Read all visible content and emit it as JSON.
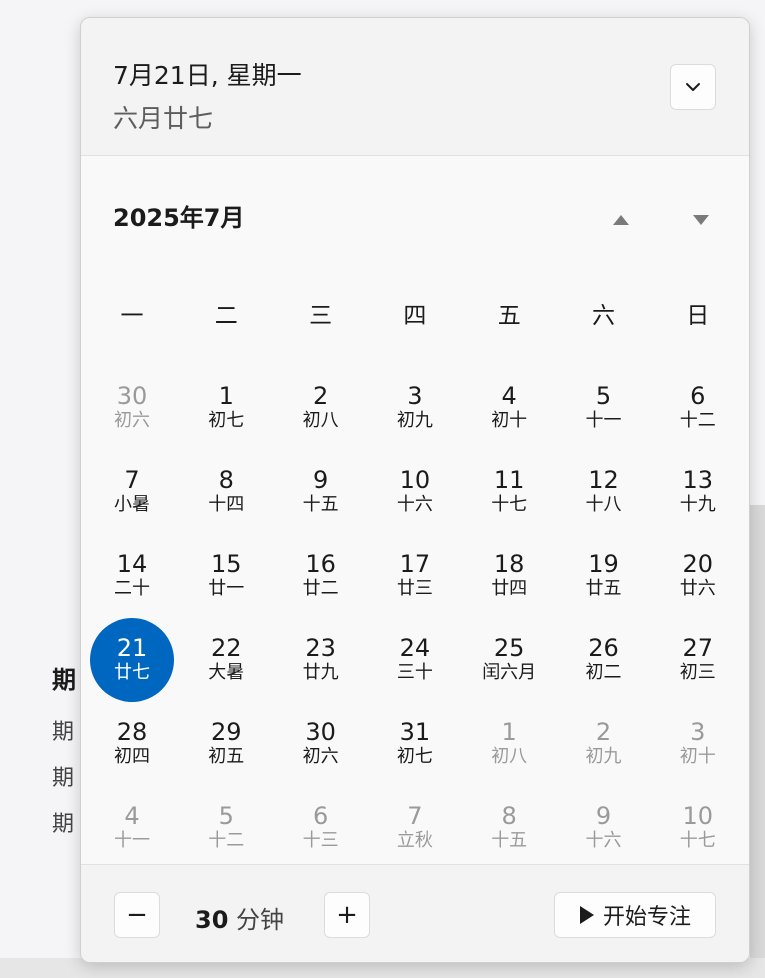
{
  "background": {
    "heading": "期",
    "lines": [
      "期",
      "期",
      "期"
    ]
  },
  "header": {
    "date": "7月21日, 星期一",
    "lunar": "六月廿七",
    "expand_icon": "chevron-down-icon"
  },
  "calendar": {
    "month_title": "2025年7月",
    "prev_icon": "triangle-up-icon",
    "next_icon": "triangle-down-icon",
    "weekdays": [
      "一",
      "二",
      "三",
      "四",
      "五",
      "六",
      "日"
    ],
    "weeks": [
      [
        {
          "day": "30",
          "lunar": "初六",
          "dim": true
        },
        {
          "day": "1",
          "lunar": "初七"
        },
        {
          "day": "2",
          "lunar": "初八"
        },
        {
          "day": "3",
          "lunar": "初九"
        },
        {
          "day": "4",
          "lunar": "初十"
        },
        {
          "day": "5",
          "lunar": "十一"
        },
        {
          "day": "6",
          "lunar": "十二"
        }
      ],
      [
        {
          "day": "7",
          "lunar": "小暑"
        },
        {
          "day": "8",
          "lunar": "十四"
        },
        {
          "day": "9",
          "lunar": "十五"
        },
        {
          "day": "10",
          "lunar": "十六"
        },
        {
          "day": "11",
          "lunar": "十七"
        },
        {
          "day": "12",
          "lunar": "十八"
        },
        {
          "day": "13",
          "lunar": "十九"
        }
      ],
      [
        {
          "day": "14",
          "lunar": "二十"
        },
        {
          "day": "15",
          "lunar": "廿一"
        },
        {
          "day": "16",
          "lunar": "廿二"
        },
        {
          "day": "17",
          "lunar": "廿三"
        },
        {
          "day": "18",
          "lunar": "廿四"
        },
        {
          "day": "19",
          "lunar": "廿五"
        },
        {
          "day": "20",
          "lunar": "廿六"
        }
      ],
      [
        {
          "day": "21",
          "lunar": "廿七",
          "selected": true
        },
        {
          "day": "22",
          "lunar": "大暑"
        },
        {
          "day": "23",
          "lunar": "廿九"
        },
        {
          "day": "24",
          "lunar": "三十"
        },
        {
          "day": "25",
          "lunar": "闰六月"
        },
        {
          "day": "26",
          "lunar": "初二"
        },
        {
          "day": "27",
          "lunar": "初三"
        }
      ],
      [
        {
          "day": "28",
          "lunar": "初四"
        },
        {
          "day": "29",
          "lunar": "初五"
        },
        {
          "day": "30",
          "lunar": "初六"
        },
        {
          "day": "31",
          "lunar": "初七"
        },
        {
          "day": "1",
          "lunar": "初八",
          "dim": true
        },
        {
          "day": "2",
          "lunar": "初九",
          "dim": true
        },
        {
          "day": "3",
          "lunar": "初十",
          "dim": true
        }
      ],
      [
        {
          "day": "4",
          "lunar": "十一",
          "dim": true
        },
        {
          "day": "5",
          "lunar": "十二",
          "dim": true
        },
        {
          "day": "6",
          "lunar": "十三",
          "dim": true
        },
        {
          "day": "7",
          "lunar": "立秋",
          "dim": true
        },
        {
          "day": "8",
          "lunar": "十五",
          "dim": true
        },
        {
          "day": "9",
          "lunar": "十六",
          "dim": true
        },
        {
          "day": "10",
          "lunar": "十七",
          "dim": true
        }
      ]
    ]
  },
  "focus": {
    "minus_label": "−",
    "duration_value": "30",
    "duration_unit": "分钟",
    "plus_label": "+",
    "start_label": "开始专注",
    "start_icon": "play-icon"
  },
  "colors": {
    "accent": "#0067c0",
    "dim_text": "#9a9a9a"
  }
}
